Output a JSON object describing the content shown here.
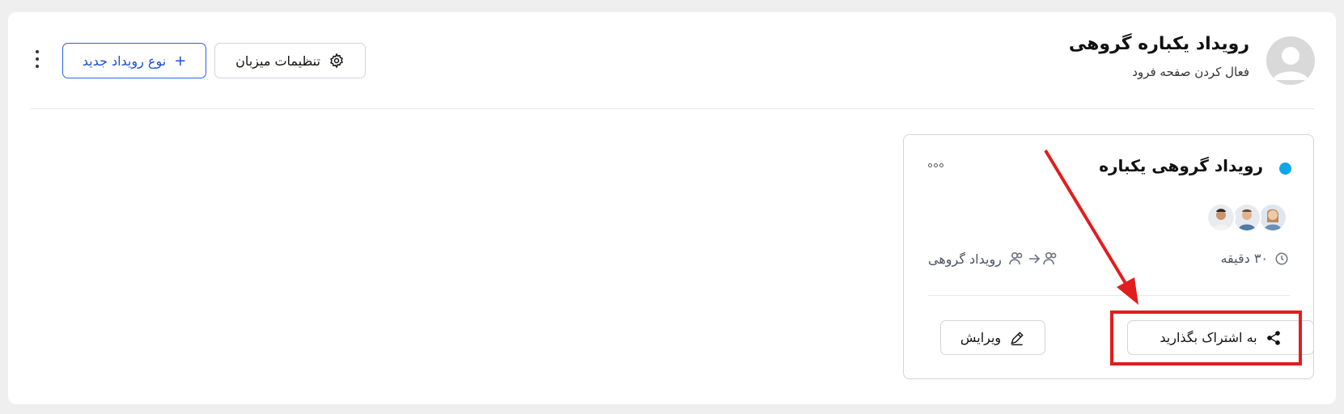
{
  "header": {
    "title": "رویداد یکباره گروهی",
    "subtitle": "فعال کردن صفحه فرود",
    "host_settings_label": "تنظیمات میزبان",
    "new_event_type_label": "نوع رویداد جدید",
    "icons": {
      "avatar": "avatar-placeholder",
      "host_settings": "gear-icon",
      "new_event_type": "plus-icon",
      "more": "kebab-icon"
    }
  },
  "event_card": {
    "title": "رویداد گروهی یکباره",
    "status_color": "#0ea5e9",
    "duration": "۳۰ دقیقه",
    "event_kind": "رویداد گروهی",
    "share_label": "به اشتراک بگذارید",
    "edit_label": "ویرایش",
    "icons": {
      "duration": "clock-icon",
      "event_kind": "group-to-group-icon",
      "share": "share-icon",
      "edit": "pencil-icon",
      "more": "ellipsis-icon"
    },
    "participants": [
      {
        "name": "participant-1",
        "color": "#c9a27a"
      },
      {
        "name": "participant-2",
        "color": "#8fa3b8"
      },
      {
        "name": "participant-3",
        "color": "#9fb7c9"
      }
    ]
  },
  "annotations": {
    "highlight_color": "#e11d1d"
  }
}
